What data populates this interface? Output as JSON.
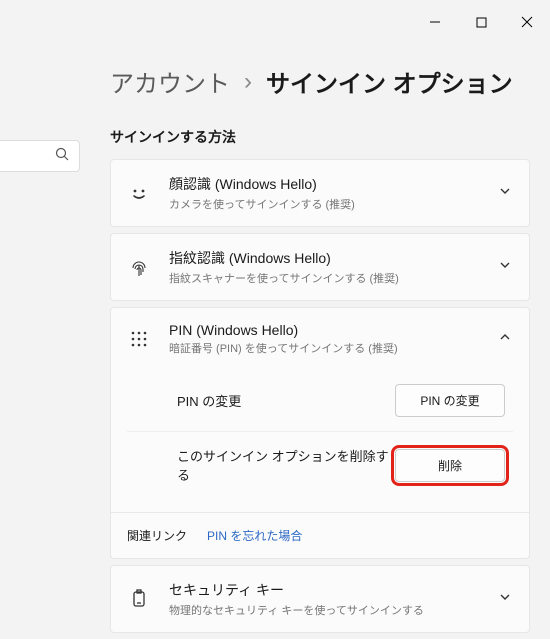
{
  "titlebar": {
    "minimize": "－",
    "maximize": "☐",
    "close": "✕"
  },
  "breadcrumb": {
    "parent": "アカウント",
    "sep": "›",
    "current": "サインイン オプション"
  },
  "section_title": "サインインする方法",
  "options": {
    "face": {
      "title": "顔認識 (Windows Hello)",
      "sub": "カメラを使ってサインインする (推奨)"
    },
    "finger": {
      "title": "指紋認識 (Windows Hello)",
      "sub": "指紋スキャナーを使ってサインインする (推奨)"
    },
    "pin": {
      "title": "PIN (Windows Hello)",
      "sub": "暗証番号 (PIN) を使ってサインインする (推奨)",
      "change_label": "PIN の変更",
      "change_btn": "PIN の変更",
      "remove_label": "このサインイン オプションを削除する",
      "remove_btn": "削除",
      "related_label": "関連リンク",
      "forgot_link": "PIN を忘れた場合"
    },
    "key": {
      "title": "セキュリティ キー",
      "sub": "物理的なセキュリティ キーを使ってサインインする"
    }
  }
}
